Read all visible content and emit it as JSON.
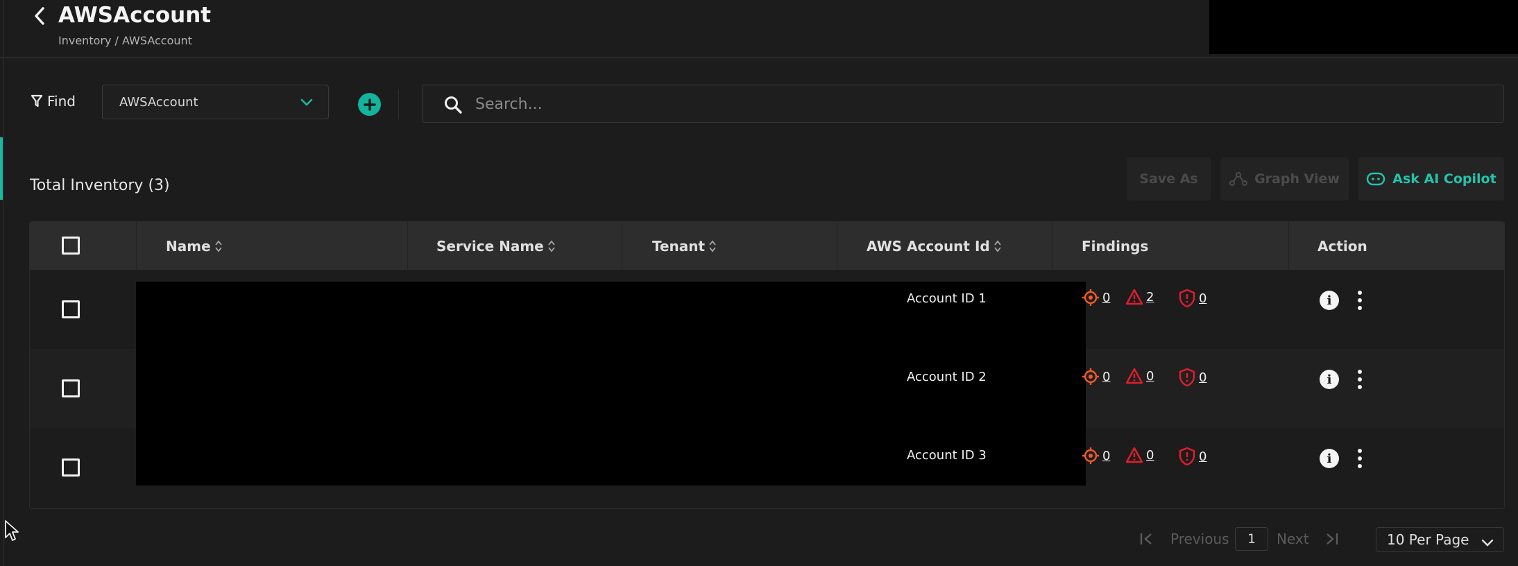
{
  "header": {
    "title": "AWSAccount",
    "breadcrumb": "Inventory / AWSAccount"
  },
  "toolbar": {
    "find_label": "Find",
    "resource_type": "AWSAccount",
    "search_placeholder": "Search..."
  },
  "summary": {
    "total_label": "Total Inventory (3)"
  },
  "actions": {
    "save_as": "Save As",
    "graph_view": "Graph View",
    "ask_ai": "Ask AI Copilot"
  },
  "table": {
    "columns": [
      "Name",
      "Service Name",
      "Tenant",
      "AWS Account Id",
      "Findings",
      "Action"
    ],
    "rows": [
      {
        "aws_account_id": "Account ID 1",
        "findings": {
          "vulnerabilities": "0",
          "misconfigurations": "2",
          "threats": "0"
        }
      },
      {
        "aws_account_id": "Account ID 2",
        "findings": {
          "vulnerabilities": "0",
          "misconfigurations": "0",
          "threats": "0"
        }
      },
      {
        "aws_account_id": "Account ID 3",
        "findings": {
          "vulnerabilities": "0",
          "misconfigurations": "0",
          "threats": "0"
        }
      }
    ]
  },
  "pagination": {
    "previous": "Previous",
    "current_page": "1",
    "next": "Next",
    "per_page": "10 Per Page"
  },
  "colors": {
    "accent": "#13b39c",
    "finding_orange": "#f05a28",
    "finding_red": "#e11d2e",
    "background": "#1c1c1c"
  }
}
